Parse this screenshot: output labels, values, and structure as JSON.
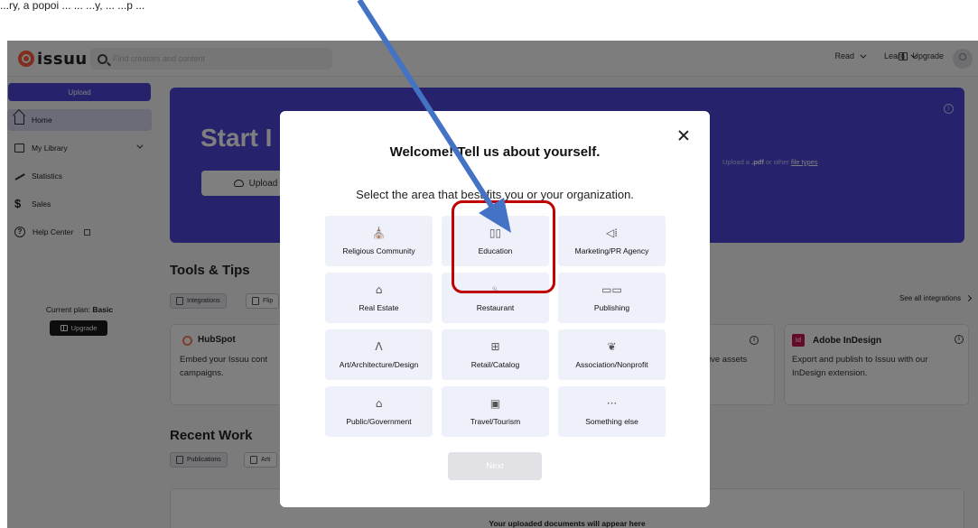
{
  "caption": "...ry, a popoi ... ... ...y, ... ...p ...",
  "topbar": {
    "logo": "issuu",
    "search_placeholder": "Find creators and content",
    "nav": [
      "Read",
      "Learn"
    ],
    "upgrade": "Upgrade"
  },
  "sidebar": {
    "upload": "Upload",
    "items": [
      {
        "label": "Home",
        "icon": "home-icon"
      },
      {
        "label": "My Library",
        "icon": "folder-icon"
      },
      {
        "label": "Statistics",
        "icon": "stats-icon"
      },
      {
        "label": "Sales",
        "icon": "dollar-icon"
      },
      {
        "label": "Help Center",
        "icon": "help-icon"
      }
    ],
    "plan_prefix": "Current plan: ",
    "plan_name": "Basic",
    "plan_upgrade": "Upgrade"
  },
  "hero": {
    "title": "Start I",
    "upload_label": "Upload",
    "right_prefix": "Upload a ",
    "right_bold": ".pdf",
    "right_mid": " or other ",
    "right_link": "file types"
  },
  "tools": {
    "title": "Tools & Tips",
    "tabs": [
      "Integrations",
      "Flip"
    ],
    "see_all": "See all integrations",
    "hubspot_title": "HubSpot",
    "hubspot_body_1": "Embed your Issuu cont",
    "hubspot_body_2": "campaigns.",
    "mid_fragment": "ive assets",
    "indesign_logo": "Id",
    "indesign_title": "Adobe InDesign",
    "indesign_body_1": "Export and publish to Issuu with our",
    "indesign_body_2": "InDesign extension."
  },
  "recent": {
    "title": "Recent Work",
    "tabs": [
      "Publications",
      "Arti"
    ],
    "empty": "Your uploaded documents will appear here"
  },
  "modal": {
    "title": "Welcome! Tell us about yourself.",
    "subtitle": "Select the area that best fits you or your organization.",
    "options": [
      {
        "label": "Religious Community",
        "icon": "⛪"
      },
      {
        "label": "Education",
        "icon": "▯▯"
      },
      {
        "label": "Marketing/PR Agency",
        "icon": "◁⁞"
      },
      {
        "label": "Real Estate",
        "icon": "⌂"
      },
      {
        "label": "Restaurant",
        "icon": "♨"
      },
      {
        "label": "Publishing",
        "icon": "▭▭"
      },
      {
        "label": "Art/Architecture/Design",
        "icon": "Λ"
      },
      {
        "label": "Retail/Catalog",
        "icon": "⊞"
      },
      {
        "label": "Association/Nonprofit",
        "icon": "❦"
      },
      {
        "label": "Public/Government",
        "icon": "⌂"
      },
      {
        "label": "Travel/Tourism",
        "icon": "▣"
      },
      {
        "label": "Something else",
        "icon": "···"
      }
    ],
    "next": "Next"
  },
  "colors": {
    "brand": "#4c46d8",
    "logo": "#ff5a3a",
    "highlight": "#c00000",
    "arrow": "#4472c4"
  }
}
